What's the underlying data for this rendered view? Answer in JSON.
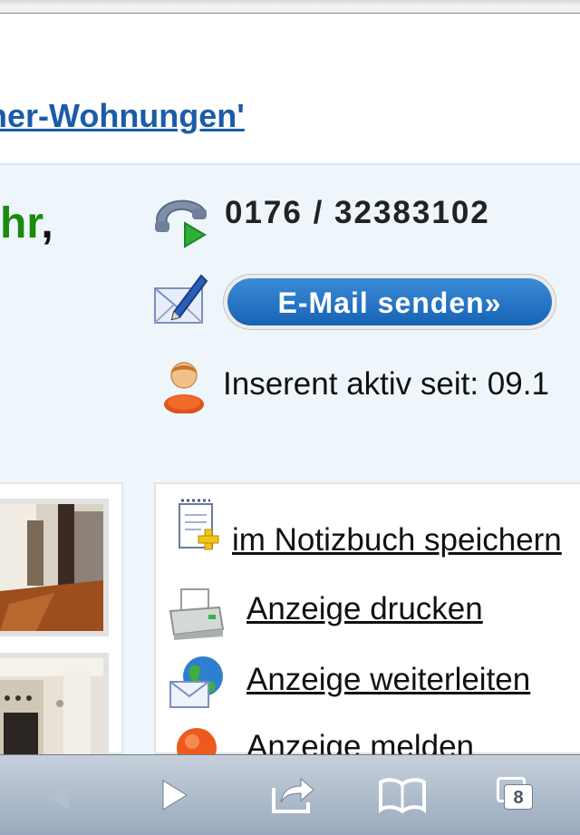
{
  "listing_link": {
    "text": "ner-Wohnungen'"
  },
  "contact": {
    "green_text": "hr",
    "comma": ",",
    "phone": "0176 / 32383102",
    "email_button": "E-Mail senden»",
    "active_since": "Inserent aktiv seit: 09.1"
  },
  "actions": [
    {
      "label": "im Notizbuch speichern",
      "icon": "notepad-add-icon"
    },
    {
      "label": "Anzeige drucken",
      "icon": "printer-icon"
    },
    {
      "label": "Anzeige weiterleiten",
      "icon": "globe-mail-icon"
    },
    {
      "label": "Anzeige melden",
      "icon": "warning-icon"
    }
  ],
  "toolbar": {
    "tabs_count": "8",
    "icons": [
      "back-icon",
      "forward-icon",
      "share-icon",
      "bookmarks-icon",
      "tabs-icon"
    ]
  },
  "colors": {
    "link": "#1a5ca8",
    "green": "#1b8a0f",
    "panel_bg": "#eef6fb",
    "button": "#1763b5"
  }
}
